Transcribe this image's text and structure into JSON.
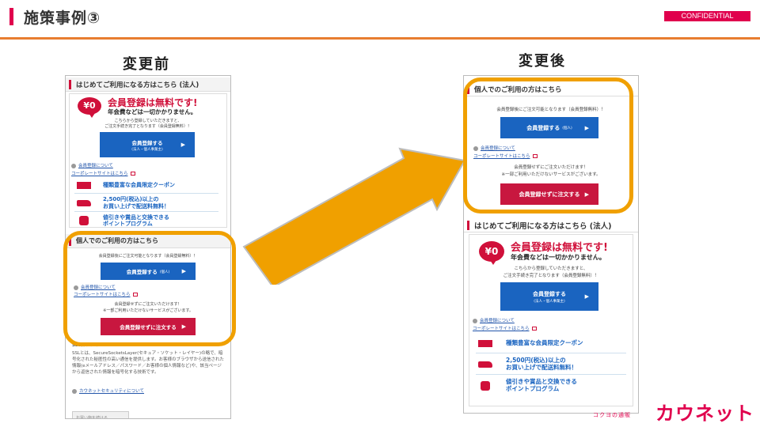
{
  "header": {
    "title": "施策事例③",
    "confidential": "CONFIDENTIAL",
    "accent_color": "#e0004d",
    "rule_color": "#e87d30"
  },
  "before": {
    "label": "変更前",
    "corporate": {
      "heading": "はじめてご利用になる方はこちら (法人)",
      "badge": "¥0",
      "free_title": "会員登録は無料です!",
      "free_sub": "年会費などは一切かかりません。",
      "note_line1": "こちらから登録していただきますと、",
      "note_line2": "ご注文手続き完了となります（会員登録無料）！",
      "register_button": "会員登録する",
      "register_button_sub": "(法人・個人事業主)",
      "about_link": "会員登録について",
      "corporate_link": "コーポレートサイトはこちら",
      "benefits": [
        {
          "icon": "coupon-icon",
          "text": "種類豊富な会員限定クーポン"
        },
        {
          "icon": "truck-icon",
          "text": "2,500円(税込)以上の\nお買い上げで配送料無料！"
        },
        {
          "icon": "gift-icon",
          "text": "値引きや賞品と交換できる\nポイントプログラム"
        }
      ]
    },
    "personal": {
      "heading": "個人でのご利用の方はこちら",
      "note": "会員登録後にご注文可能となります（会員登録無料）！",
      "register_button": "会員登録する",
      "register_button_sub": "(個人)",
      "about_link": "会員登録について",
      "corporate_link": "コーポレートサイトはこちら",
      "guest_note1": "会員登録せずにご注文いただけます！",
      "guest_note2": "※一部ご利用いただけないサービスがございます。",
      "guest_button": "会員登録せずに注文する"
    },
    "ssl": {
      "heading": "SSLについて",
      "body": "SSLとは、SecureSocketsLayer(セキュア・ソケット・レイヤー)の略で、暗号化された秘匿性の高い通信を提供します。お客様のブラウザから送信された情報(eメールアドレス／パスワード／お客様の個人情報など)や、該当ページから返信された情報を暗号化する技術です。",
      "link": "カウネットセキュリティについて",
      "back_button": "お買い物を続ける"
    }
  },
  "after": {
    "label": "変更後",
    "personal": {
      "heading": "個人でのご利用の方はこちら",
      "note": "会員登録後にご注文可能となります（会員登録無料）！",
      "register_button": "会員登録する",
      "register_button_sub": "(個人)",
      "about_link": "会員登録について",
      "corporate_link": "コーポレートサイトはこちら",
      "guest_note1": "会員登録せずにご注文いただけます！",
      "guest_note2": "※一部ご利用いただけないサービスがございます。",
      "guest_button": "会員登録せずに注文する"
    },
    "corporate": {
      "heading": "はじめてご利用になる方はこちら (法人)",
      "badge": "¥0",
      "free_title": "会員登録は無料です!",
      "free_sub": "年会費などは一切かかりません。",
      "note_line1": "こちらから登録していただきますと、",
      "note_line2": "ご注文手続き完了となります（会員登録無料）！",
      "register_button": "会員登録する",
      "register_button_sub": "(法人・個人事業主)",
      "about_link": "会員登録について",
      "corporate_link": "コーポレートサイトはこちら",
      "benefits": [
        {
          "icon": "coupon-icon",
          "text": "種類豊富な会員限定クーポン"
        },
        {
          "icon": "truck-icon",
          "text": "2,500円(税込)以上の\nお買い上げで配送料無料！"
        },
        {
          "icon": "gift-icon",
          "text": "値引きや賞品と交換できる\nポイントプログラム"
        }
      ]
    }
  },
  "highlight_color": "#f0a000",
  "arrow_color": "#f0a000",
  "brand": {
    "tagline": "コクヨの通販",
    "name": "カウネット"
  }
}
